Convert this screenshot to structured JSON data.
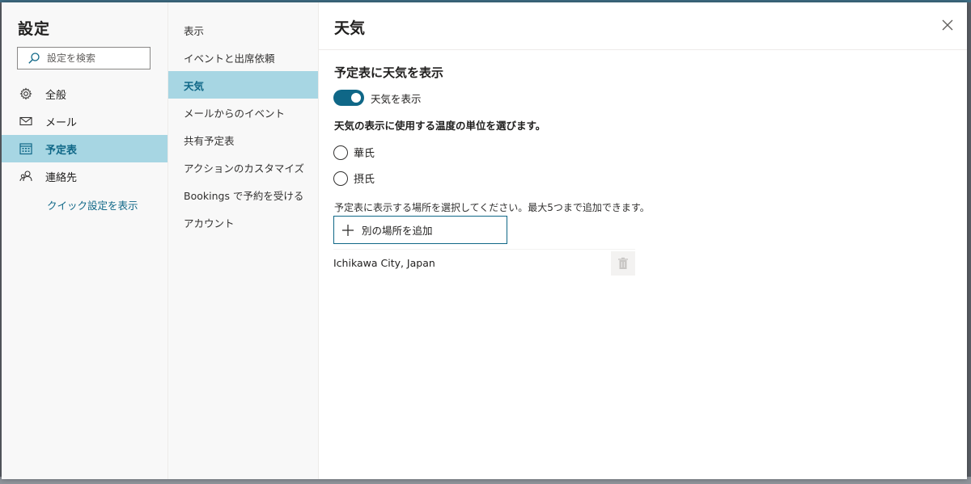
{
  "sidebar": {
    "title": "設定",
    "search_placeholder": "設定を検索",
    "items": [
      {
        "label": "全般",
        "icon": "gear-icon"
      },
      {
        "label": "メール",
        "icon": "mail-icon"
      },
      {
        "label": "予定表",
        "icon": "calendar-icon",
        "active": true
      },
      {
        "label": "連絡先",
        "icon": "people-icon"
      }
    ],
    "quick_settings_link": "クイック設定を表示"
  },
  "subnav": {
    "items": [
      {
        "label": "表示"
      },
      {
        "label": "イベントと出席依頼"
      },
      {
        "label": "天気",
        "active": true
      },
      {
        "label": "メールからのイベント"
      },
      {
        "label": "共有予定表"
      },
      {
        "label": "アクションのカスタマイズ"
      },
      {
        "label": "Bookings で予約を受ける"
      },
      {
        "label": "アカウント"
      }
    ]
  },
  "main": {
    "title": "天気",
    "section_title": "予定表に天気を表示",
    "toggle": {
      "label": "天気を表示",
      "on": true
    },
    "unit_question": "天気の表示に使用する温度の単位を選びます。",
    "units": [
      {
        "label": "華氏",
        "selected": false
      },
      {
        "label": "摂氏",
        "selected": false
      }
    ],
    "location_hint": "予定表に表示する場所を選択してください。最大5つまで追加できます。",
    "add_location_label": "別の場所を追加",
    "locations": [
      {
        "name": "Ichikawa City, Japan"
      }
    ]
  },
  "colors": {
    "accent": "#0f6787",
    "selected_bg": "#a7d6e3"
  }
}
